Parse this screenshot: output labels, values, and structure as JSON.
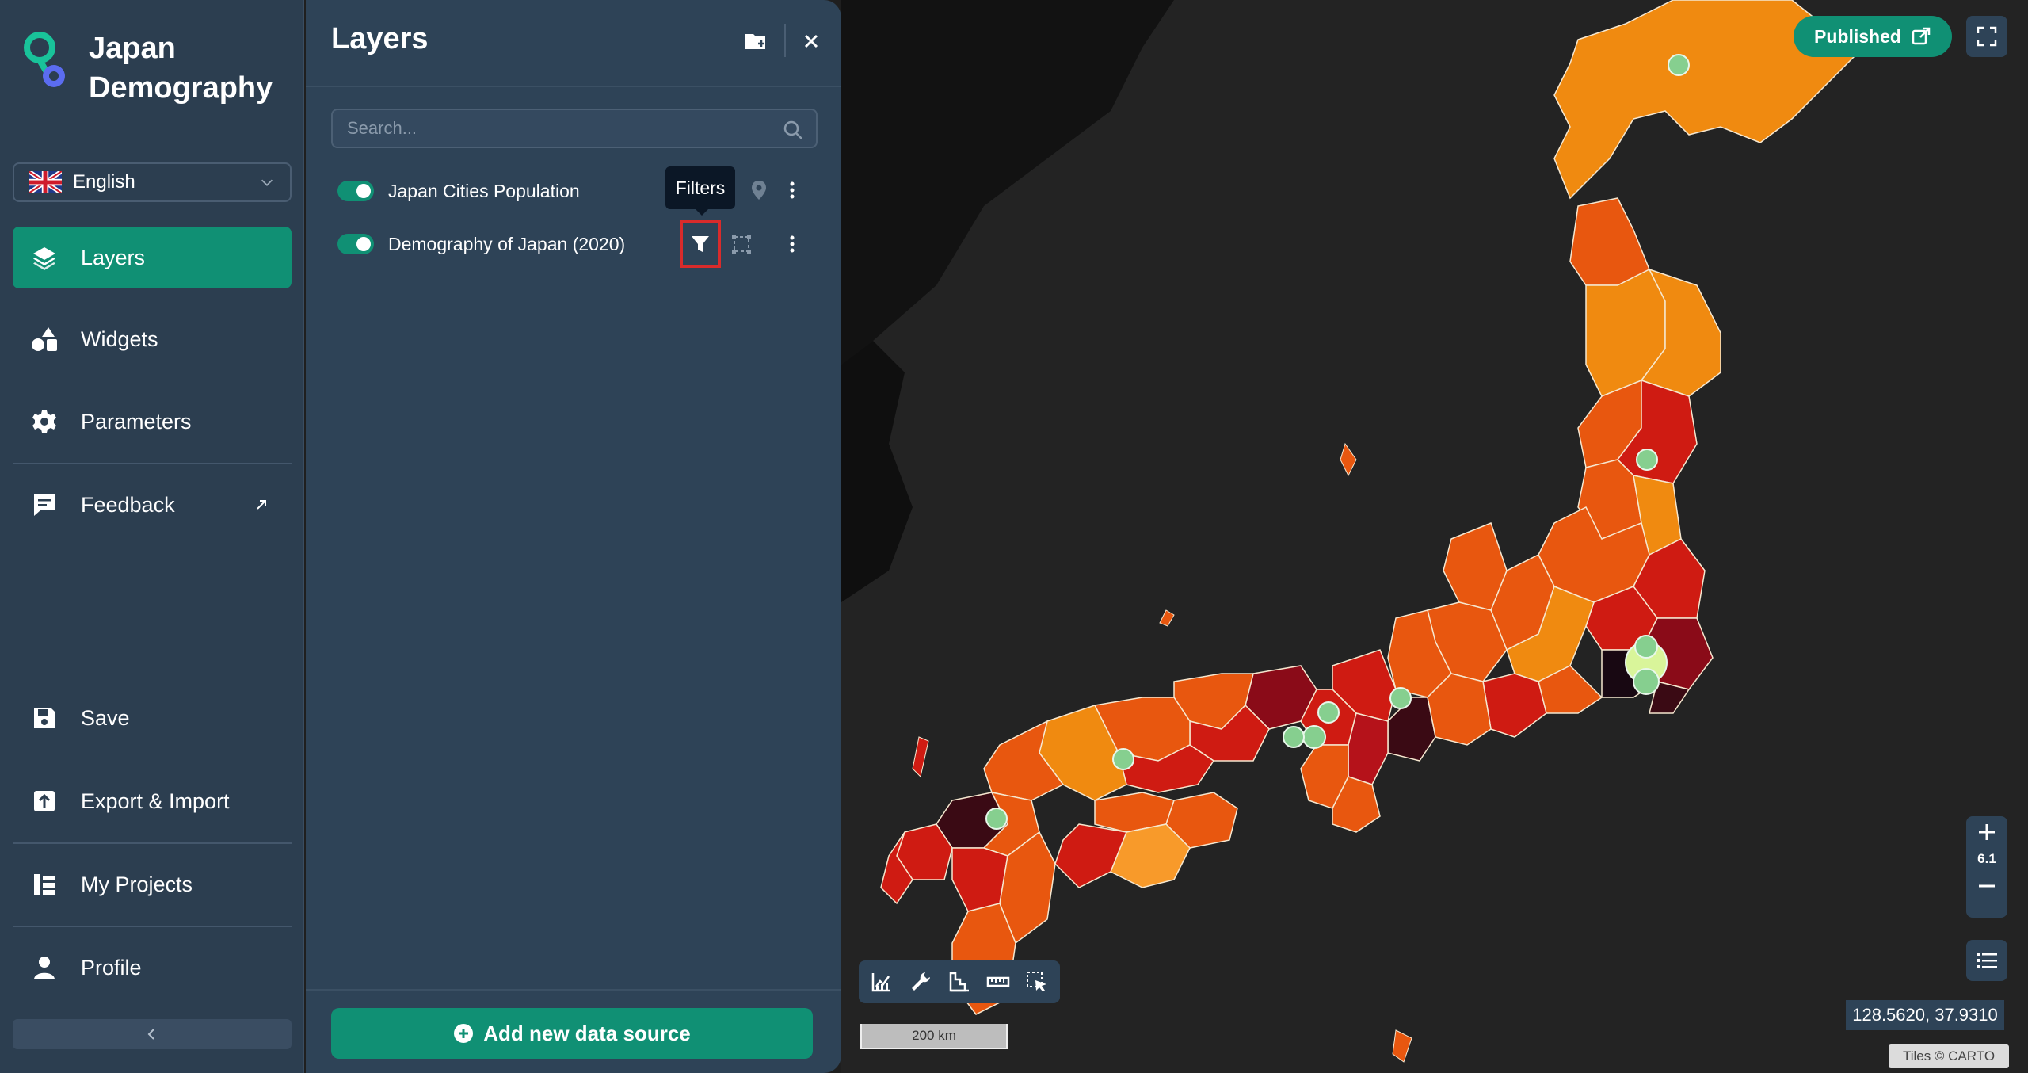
{
  "app": {
    "title": "Japan Demography"
  },
  "language": {
    "selected": "English"
  },
  "nav": {
    "layers": "Layers",
    "widgets": "Widgets",
    "parameters": "Parameters",
    "feedback": "Feedback",
    "save": "Save",
    "export_import": "Export & Import",
    "my_projects": "My Projects",
    "profile": "Profile"
  },
  "panel": {
    "title": "Layers",
    "search_placeholder": "Search...",
    "layers": [
      {
        "name": "Japan Cities Population",
        "visible": true
      },
      {
        "name": "Demography of Japan (2020)",
        "visible": true
      }
    ],
    "tooltip": "Filters",
    "add_button": "Add new data source"
  },
  "map": {
    "published_label": "Published",
    "zoom_level": "6.1",
    "scale_label": "200 km",
    "coordinates": "128.5620, 37.9310",
    "attribution": "Tiles © CARTO"
  },
  "colors": {
    "accent": "#109074",
    "sidebar_bg": "#2c3e50",
    "panel_bg": "#2e4357",
    "highlight": "#d92b2b",
    "city_point": "#86cf8f",
    "city_point_large": "#d9f59a"
  },
  "icons": {
    "logo": "map-pin-logo",
    "flag": "uk-flag",
    "layers": "layers-icon",
    "widgets": "widgets-icon",
    "parameters": "gear-icon",
    "feedback": "chat-icon",
    "save": "floppy-icon",
    "export": "upload-icon",
    "projects": "projects-icon",
    "profile": "user-icon"
  }
}
